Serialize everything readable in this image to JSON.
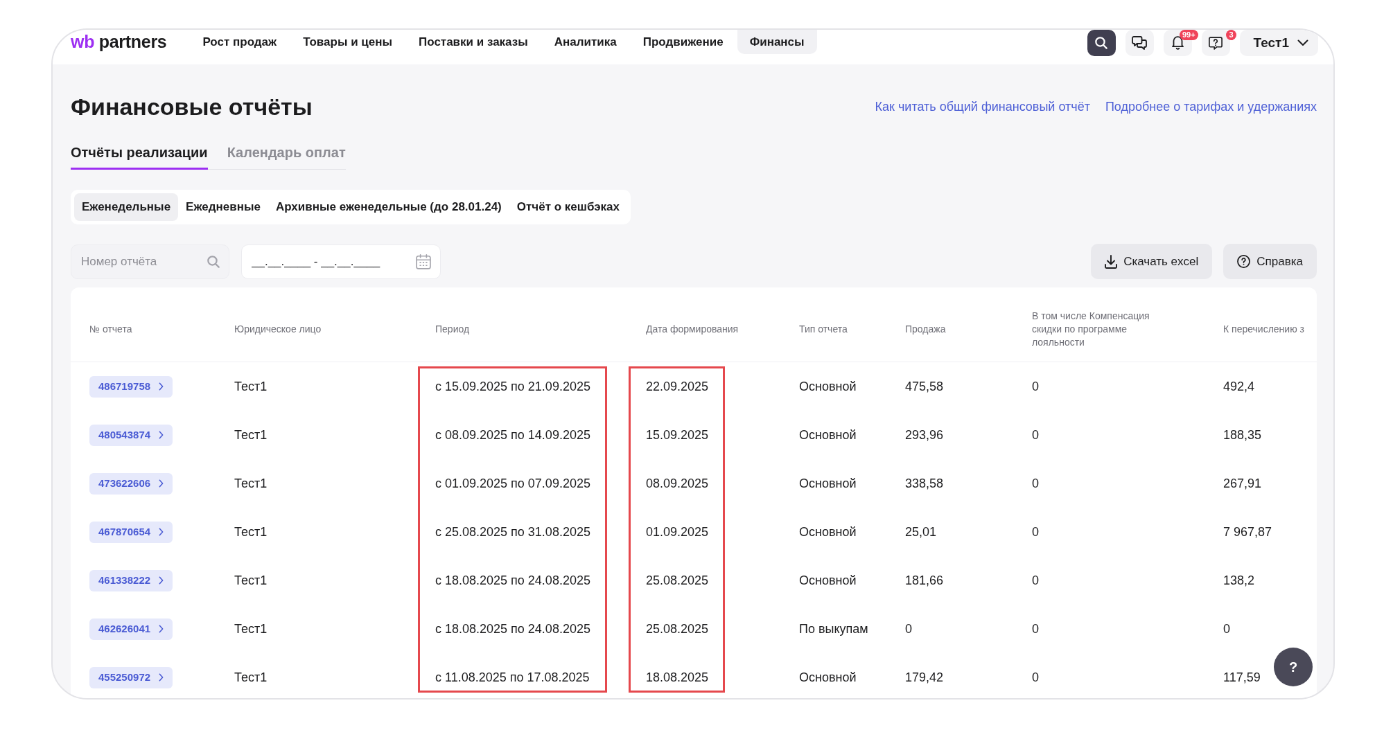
{
  "logo": {
    "mark": "wb",
    "text": "partners"
  },
  "nav": [
    {
      "label": "Рост продаж",
      "selected": false
    },
    {
      "label": "Товары и цены",
      "selected": false
    },
    {
      "label": "Поставки и заказы",
      "selected": false
    },
    {
      "label": "Аналитика",
      "selected": false
    },
    {
      "label": "Продвижение",
      "selected": false
    },
    {
      "label": "Финансы",
      "selected": true
    }
  ],
  "header_actions": [
    {
      "kind": "search"
    },
    {
      "kind": "chat"
    },
    {
      "kind": "notifications",
      "badge": "99+"
    },
    {
      "kind": "support",
      "badge": "3"
    }
  ],
  "user": {
    "name": "Тест1"
  },
  "page_title": "Финансовые отчёты",
  "help_links": [
    "Как читать общий финансовый отчёт",
    "Подробнее о тарифах и удержаниях"
  ],
  "tabs": [
    {
      "label": "Отчёты реализации",
      "selected": true
    },
    {
      "label": "Календарь оплат",
      "selected": false
    }
  ],
  "report_types": [
    {
      "label": "Еженедельные",
      "selected": true
    },
    {
      "label": "Ежедневные",
      "selected": false
    },
    {
      "label": "Архивные еженедельные (до 28.01.24)",
      "selected": false
    },
    {
      "label": "Отчёт о кешбэках",
      "selected": false
    }
  ],
  "filters": {
    "report_number": {
      "placeholder": "Номер отчёта"
    },
    "period": {
      "value": "__.__.____ - __.__.____"
    }
  },
  "toolbar_buttons": [
    {
      "kind": "download",
      "label": "Скачать excel"
    },
    {
      "kind": "help",
      "label": "Справка"
    }
  ],
  "table": {
    "columns": [
      {
        "label": "№ отчета",
        "kind": "link",
        "highlighted": false
      },
      {
        "label": "Юридическое лицо",
        "kind": "text",
        "highlighted": false
      },
      {
        "label": "Период",
        "kind": "text",
        "highlighted": true
      },
      {
        "label": "Дата формирования",
        "kind": "text",
        "highlighted": true
      },
      {
        "label": "Тип отчета",
        "kind": "text",
        "highlighted": false
      },
      {
        "label": "Продажа",
        "kind": "text",
        "highlighted": false
      },
      {
        "label": "В том числе Компенсация скидки по программе лояльности",
        "kind": "text",
        "highlighted": false
      },
      {
        "label": "К перечислению з",
        "kind": "text",
        "highlighted": false
      }
    ],
    "rows": [
      {
        "cells": [
          "486719758",
          "Тест1",
          "с 15.09.2025 по 21.09.2025",
          "22.09.2025",
          "Основной",
          "475,58",
          "0",
          "492,4"
        ]
      },
      {
        "cells": [
          "480543874",
          "Тест1",
          "с 08.09.2025 по 14.09.2025",
          "15.09.2025",
          "Основной",
          "293,96",
          "0",
          "188,35"
        ]
      },
      {
        "cells": [
          "473622606",
          "Тест1",
          "с 01.09.2025 по 07.09.2025",
          "08.09.2025",
          "Основной",
          "338,58",
          "0",
          "267,91"
        ]
      },
      {
        "cells": [
          "467870654",
          "Тест1",
          "с 25.08.2025 по 31.08.2025",
          "01.09.2025",
          "Основной",
          "25,01",
          "0",
          "7 967,87"
        ]
      },
      {
        "cells": [
          "461338222",
          "Тест1",
          "с 18.08.2025 по 24.08.2025",
          "25.08.2025",
          "Основной",
          "181,66",
          "0",
          "138,2"
        ]
      },
      {
        "cells": [
          "462626041",
          "Тест1",
          "с 18.08.2025 по 24.08.2025",
          "25.08.2025",
          "По выкупам",
          "0",
          "0",
          "0"
        ]
      },
      {
        "cells": [
          "455250972",
          "Тест1",
          "с 11.08.2025 по 17.08.2025",
          "18.08.2025",
          "Основной",
          "179,42",
          "0",
          "117,59"
        ]
      }
    ]
  },
  "help_button": {
    "label": "?"
  }
}
